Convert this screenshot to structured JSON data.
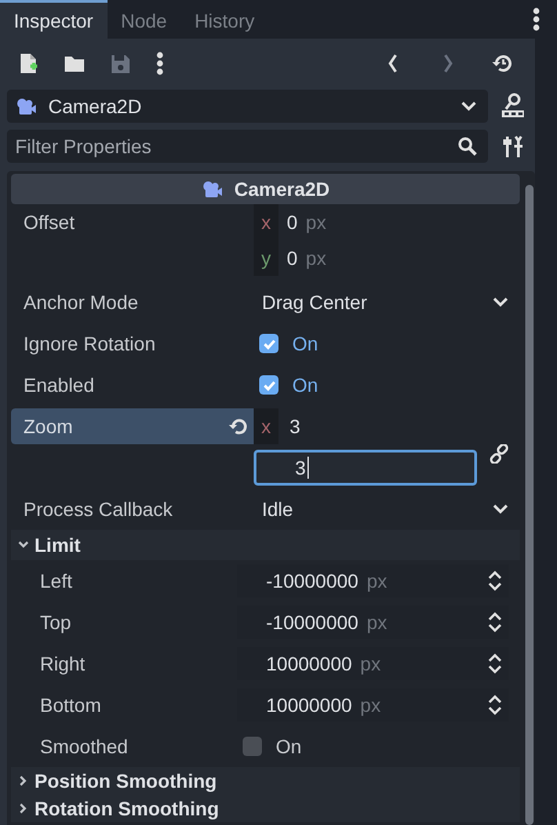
{
  "tabs": [
    {
      "label": "Inspector",
      "selected": true
    },
    {
      "label": "Node",
      "selected": false
    },
    {
      "label": "History",
      "selected": false
    }
  ],
  "node_selector": {
    "value": "Camera2D"
  },
  "filter": {
    "placeholder": "Filter Properties"
  },
  "section_header": "Camera2D",
  "properties": [
    {
      "kind": "vector",
      "label": "Offset",
      "selected": false,
      "components": [
        {
          "axis": "x",
          "value": "0",
          "unit": "px",
          "focused": false
        },
        {
          "axis": "y",
          "value": "0",
          "unit": "px",
          "focused": false
        }
      ]
    },
    {
      "kind": "dropdown",
      "label": "Anchor Mode",
      "selected": false,
      "value": "Drag Center"
    },
    {
      "kind": "checkbox",
      "label": "Ignore Rotation",
      "selected": false,
      "checked": true,
      "text": "On"
    },
    {
      "kind": "checkbox",
      "label": "Enabled",
      "selected": false,
      "checked": true,
      "text": "On"
    },
    {
      "kind": "linked",
      "label": "Zoom",
      "selected": true,
      "components": [
        {
          "axis": "x",
          "value": "3",
          "focused": false
        },
        {
          "value": "3",
          "focused": true
        }
      ]
    },
    {
      "kind": "dropdown",
      "label": "Process Callback",
      "selected": false,
      "value": "Idle"
    },
    {
      "kind": "group",
      "label": "Limit",
      "selected": false,
      "expanded": true,
      "children": [
        {
          "kind": "spin",
          "label": "Left",
          "selected": false,
          "value": "-10000000",
          "unit": "px"
        },
        {
          "kind": "spin",
          "label": "Top",
          "selected": false,
          "value": "-10000000",
          "unit": "px"
        },
        {
          "kind": "spin",
          "label": "Right",
          "selected": false,
          "value": "10000000",
          "unit": "px"
        },
        {
          "kind": "spin",
          "label": "Bottom",
          "selected": false,
          "value": "10000000",
          "unit": "px"
        },
        {
          "kind": "checkbox",
          "label": "Smoothed",
          "selected": false,
          "checked": false,
          "text": "On"
        }
      ]
    },
    {
      "kind": "group",
      "label": "Position Smoothing",
      "selected": false,
      "expanded": false
    },
    {
      "kind": "group",
      "label": "Rotation Smoothing",
      "selected": false,
      "expanded": false
    }
  ]
}
